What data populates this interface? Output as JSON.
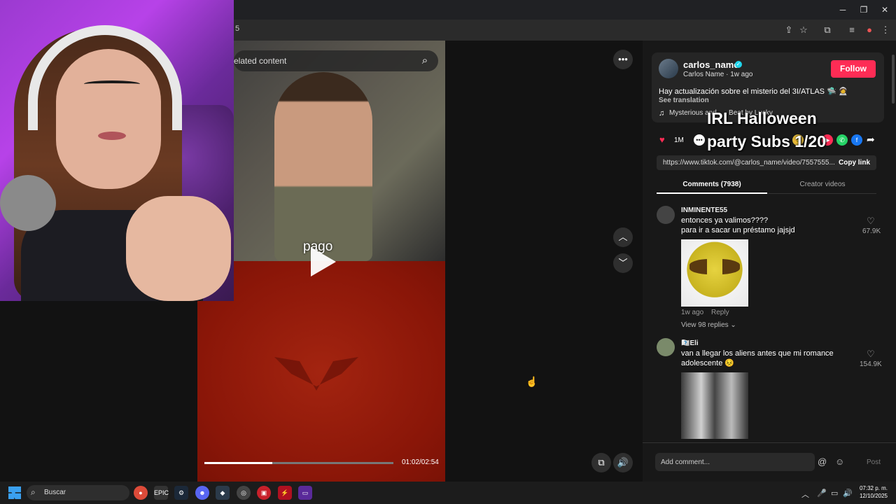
{
  "window": {
    "minimize_glyph": "─",
    "restore_glyph": "❐",
    "close_glyph": "✕",
    "url_fragment": "5"
  },
  "video": {
    "search_placeholder": "elated content",
    "caption_word": "pago",
    "time": "01:02/02:54",
    "progress": 0.36
  },
  "creator": {
    "name": "carlos_name",
    "sub": "Carlos Name · 1w ago",
    "follow_label": "Follow",
    "description": "Hay actualización sobre el misterio del 3I/ATLAS 🛸 🧑‍🚀",
    "see_translation": "See translation",
    "music": "Mysterious and... - Beat by Lucky"
  },
  "overlay": {
    "line1": "IRL Halloween",
    "line2": "party Subs 1/20"
  },
  "actions": {
    "likes": "1M",
    "link": "https://www.tiktok.com/@carlos_name/video/7557555...",
    "copy_link": "Copy link"
  },
  "tabs": {
    "comments": "Comments (7938)",
    "creator_videos": "Creator videos"
  },
  "comments": [
    {
      "user": "INMINENTE55",
      "text_line1": "entonces ya valimos????",
      "text_line2": "para ir a sacar un préstamo jajsjd",
      "likes": "67.9K",
      "time": "1w ago",
      "reply": "Reply",
      "view_replies": "View 98 replies ⌄"
    },
    {
      "user": "🇽🇽Eli",
      "text_line1": "van a llegar los aliens antes que mi romance",
      "text_line2": "adolescente 😣",
      "likes": "154.9K"
    }
  ],
  "comment_input": {
    "placeholder": "Add comment...",
    "post_label": "Post"
  },
  "taskbar": {
    "search_label": "Buscar",
    "time": "07:32 p. m.",
    "date": "12/10/2025"
  },
  "colors": {
    "follow": "#fe2c55",
    "verified": "#20d5ec"
  }
}
